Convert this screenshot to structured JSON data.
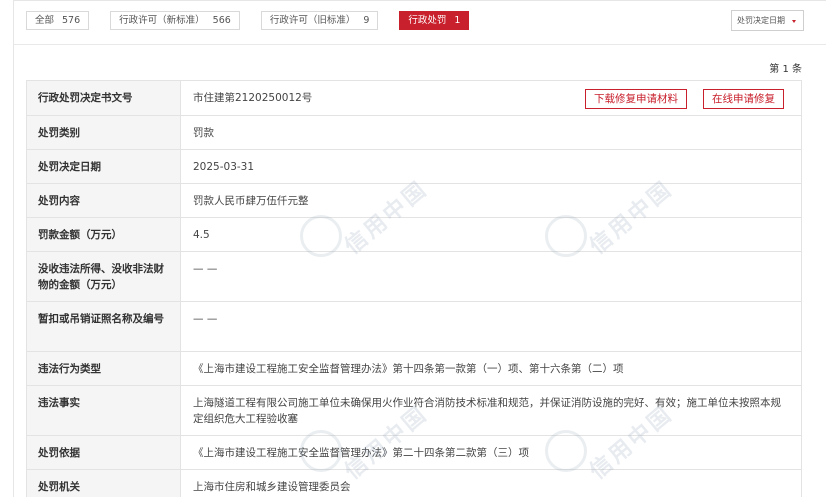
{
  "tabs": [
    {
      "label": "全部",
      "count": "576",
      "active": false
    },
    {
      "label": "行政许可（新标准）",
      "count": "566",
      "active": false
    },
    {
      "label": "行政许可（旧标准）",
      "count": "9",
      "active": false
    },
    {
      "label": "行政处罚",
      "count": "1",
      "active": true
    }
  ],
  "sort": {
    "label": "处罚决定日期"
  },
  "pagination": {
    "text": "第 1 条"
  },
  "actions": {
    "download_label": "下载修复申请材料",
    "online_label": "在线申请修复"
  },
  "watermark": {
    "text": "信用中国"
  },
  "colors": {
    "accent": "#c8202c",
    "label_bg": "#f5f5f5",
    "border": "#e3e3e3"
  },
  "rows": [
    {
      "label": "行政处罚决定书文号",
      "value": "市住建第2120250012号"
    },
    {
      "label": "处罚类别",
      "value": "罚款"
    },
    {
      "label": "处罚决定日期",
      "value": "2025-03-31"
    },
    {
      "label": "处罚内容",
      "value": "罚款人民币肆万伍仟元整"
    },
    {
      "label": "罚款金额（万元）",
      "value": "4.5"
    },
    {
      "label": "没收违法所得、没收非法财物的金额（万元）",
      "value": "— —"
    },
    {
      "label": "暂扣或吊销证照名称及编号",
      "value": "— —"
    },
    {
      "label": "违法行为类型",
      "value": "《上海市建设工程施工安全监督管理办法》第十四条第一款第（一）项、第十六条第（二）项"
    },
    {
      "label": "违法事实",
      "value": "上海隧道工程有限公司施工单位未确保用火作业符合消防技术标准和规范，并保证消防设施的完好、有效；施工单位未按照本规定组织危大工程验收塞"
    },
    {
      "label": "处罚依据",
      "value": "《上海市建设工程施工安全监督管理办法》第二十四条第二款第（三）项"
    },
    {
      "label": "处罚机关",
      "value": "上海市住房和城乡建设管理委员会"
    }
  ]
}
